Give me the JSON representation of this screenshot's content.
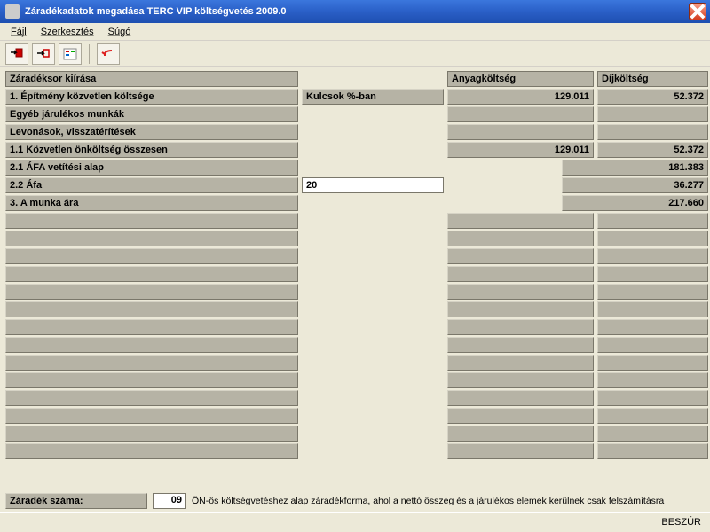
{
  "window": {
    "title": "Záradékadatok megadása    TERC VIP költségvetés 2009.0"
  },
  "menu": {
    "file": "Fájl",
    "edit": "Szerkesztés",
    "help": "Súgó"
  },
  "headers": {
    "col1": "Záradéksor kiírása",
    "col2": "",
    "col3": "Anyagköltség",
    "col4": "Díjköltség"
  },
  "rows": [
    {
      "label": "1. Építmény közvetlen költsége",
      "mid": "Kulcsok %-ban",
      "c3": "129.011",
      "c4": "52.372"
    },
    {
      "label": "Egyéb járulékos munkák",
      "mid": "",
      "c3": "",
      "c4": ""
    },
    {
      "label": "Levonások, visszatérítések",
      "mid": "",
      "c3": "",
      "c4": ""
    },
    {
      "label": "1.1 Közvetlen önköltség összesen",
      "mid": "",
      "c3": "129.011",
      "c4": "52.372"
    },
    {
      "label": "2.1 ÁFA vetítési alap",
      "mid": "",
      "sum": "181.383"
    },
    {
      "label": "2.2 Áfa",
      "mid_input": "20",
      "sum": "36.277"
    },
    {
      "label": "3.  A munka ára",
      "mid": "",
      "sum": "217.660"
    }
  ],
  "footer": {
    "label": "Záradék száma:",
    "number": "09",
    "description": "ÖN-ös költségvetéshez alap záradékforma, ahol a nettó összeg és a járulékos elemek kerülnek csak felszámításra"
  },
  "status": {
    "mode": "BESZÚR"
  }
}
